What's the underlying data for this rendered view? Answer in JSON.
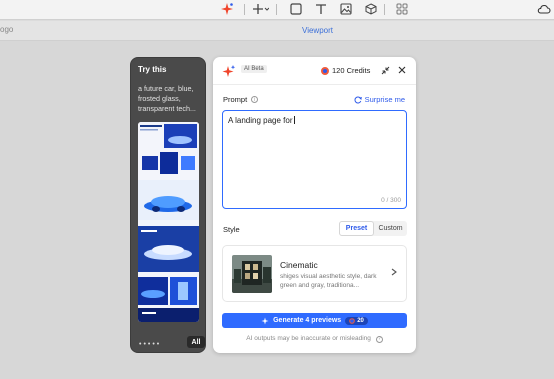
{
  "toolbar": {
    "icons": [
      "ai-sparkle-icon",
      "plus-icon",
      "rectangle-icon",
      "text-icon",
      "image-icon",
      "cube-icon",
      "grid-icon"
    ]
  },
  "ruler": {
    "left_label": "ogo",
    "viewport_label": "Viewport"
  },
  "try_panel": {
    "title": "Try this",
    "description": "a future car, blue, frosted glass, transparent tech...",
    "all_label": "All"
  },
  "ai_panel": {
    "beta_label": "AI Beta",
    "credits_label": "120 Credits",
    "prompt_label": "Prompt",
    "surprise_label": "Surprise me",
    "prompt_value": "A landing page for",
    "counter": "0 / 300",
    "style_label": "Style",
    "segments": [
      "Preset",
      "Custom"
    ],
    "style_name": "Cinematic",
    "style_description": "shiges visual aesthetic style, dark green and gray, traditiona...",
    "generate_label": "Generate 4 previews",
    "generate_cost": "20",
    "disclaimer": "AI outputs may be inaccurate or misleading"
  },
  "colors": {
    "accent": "#2f6bff",
    "panel_dark": "#4a4a4a"
  }
}
